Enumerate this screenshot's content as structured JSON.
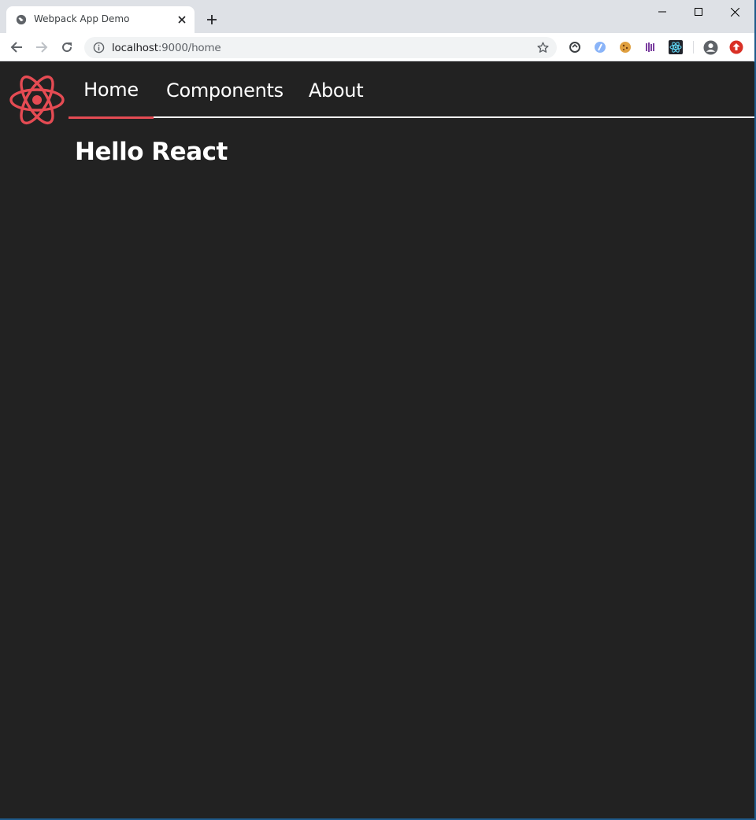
{
  "browser": {
    "tab_title": "Webpack App Demo",
    "url_host": "localhost",
    "url_path": ":9000/home"
  },
  "app": {
    "nav": [
      {
        "label": "Home"
      },
      {
        "label": "Components"
      },
      {
        "label": "About"
      }
    ],
    "active_nav": "Home",
    "heading": "Hello React"
  },
  "colors": {
    "background": "#222222",
    "accent": "#e54b53",
    "text": "#ffffff"
  }
}
